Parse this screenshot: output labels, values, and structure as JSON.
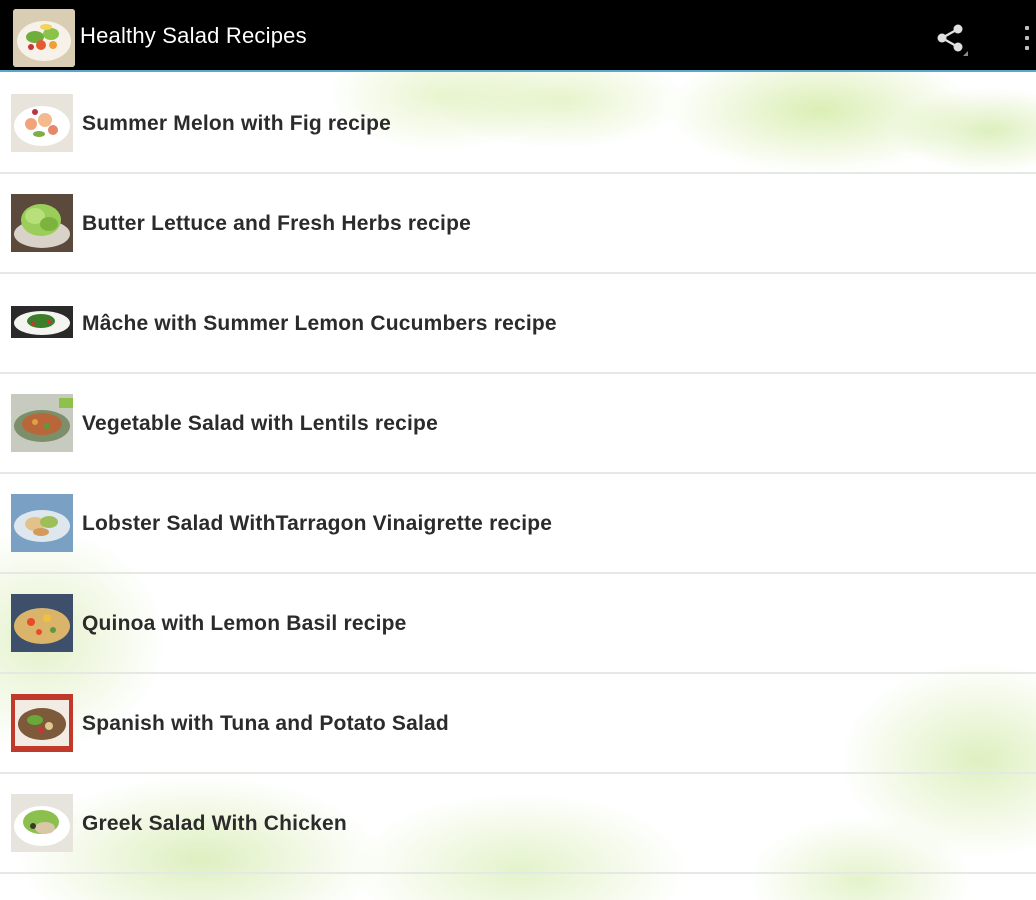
{
  "app": {
    "title": "Healthy Salad Recipes",
    "actions": {
      "share_icon": "share-icon",
      "overflow_icon": "overflow-menu-icon"
    },
    "accent_color": "#5aa8c9"
  },
  "recipes": [
    {
      "label": "Summer Melon with Fig recipe",
      "thumb": "salad-photo"
    },
    {
      "label": "Butter Lettuce and Fresh Herbs recipe",
      "thumb": "salad-photo"
    },
    {
      "label": "Mâche with Summer Lemon Cucumbers recipe",
      "thumb": "salad-photo"
    },
    {
      "label": "Vegetable Salad with Lentils recipe",
      "thumb": "salad-photo"
    },
    {
      "label": "Lobster Salad WithTarragon Vinaigrette recipe",
      "thumb": "salad-photo"
    },
    {
      "label": "Quinoa with Lemon Basil recipe",
      "thumb": "salad-photo"
    },
    {
      "label": "Spanish with Tuna and Potato Salad",
      "thumb": "salad-photo"
    },
    {
      "label": "Greek Salad With Chicken",
      "thumb": "salad-photo"
    }
  ]
}
